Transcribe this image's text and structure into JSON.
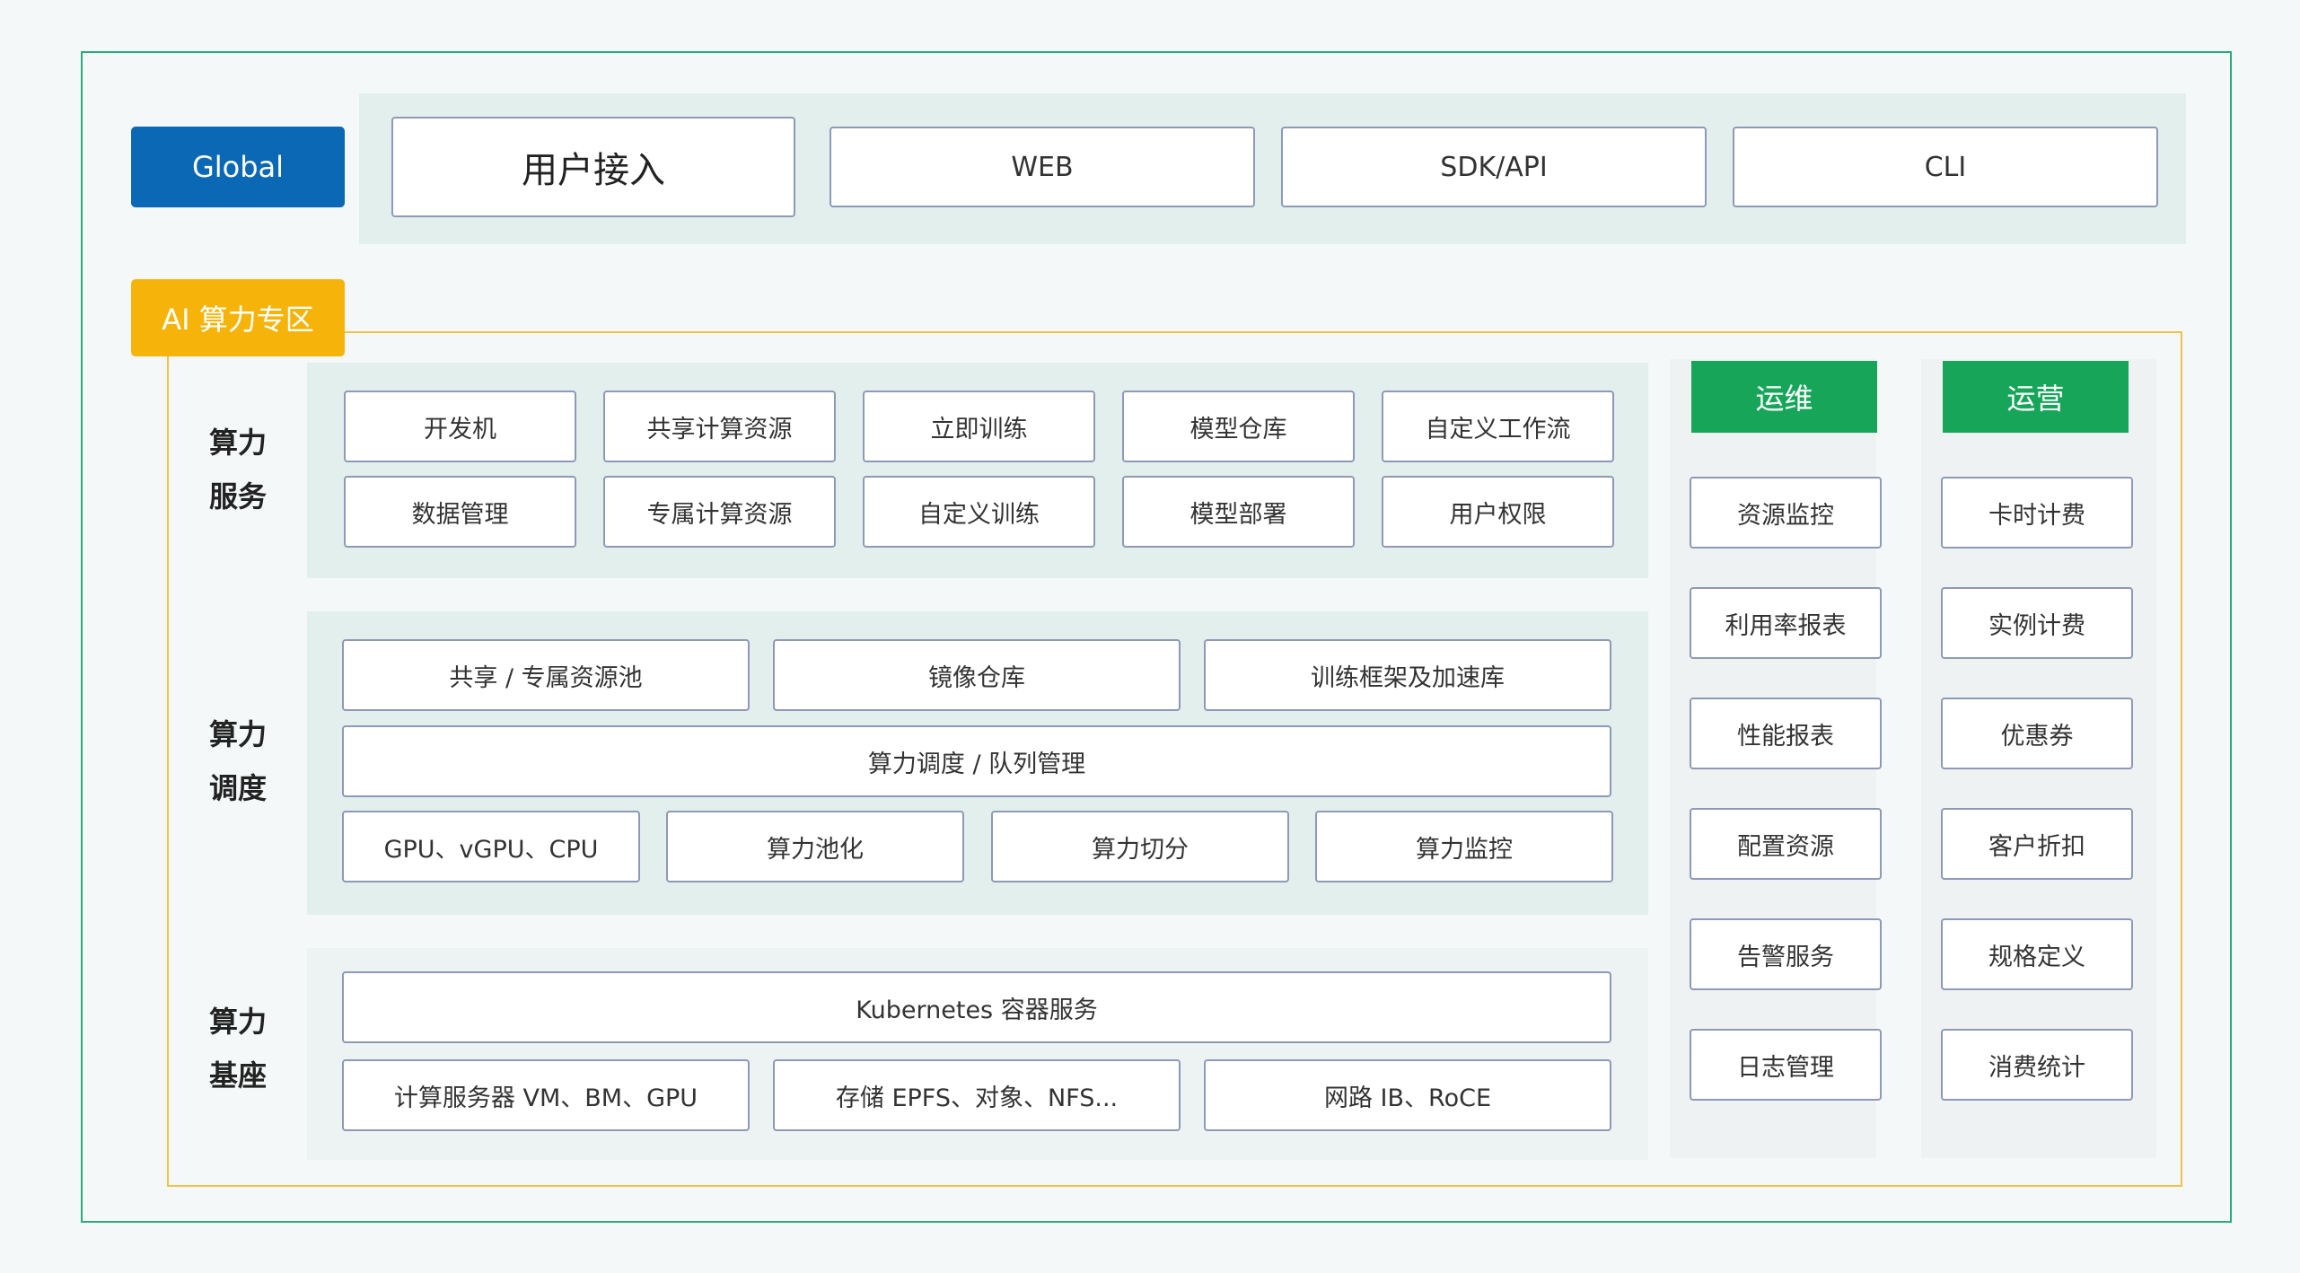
{
  "global": {
    "tag": "Global",
    "user_access": "用户接入",
    "channels": [
      "WEB",
      "SDK/API",
      "CLI"
    ]
  },
  "ai_zone": {
    "tag": "AI 算力专区",
    "service": {
      "label_line1": "算力",
      "label_line2": "服务",
      "row1": [
        "开发机",
        "共享计算资源",
        "立即训练",
        "模型仓库",
        "自定义工作流"
      ],
      "row2": [
        "数据管理",
        "专属计算资源",
        "自定义训练",
        "模型部署",
        "用户权限"
      ]
    },
    "scheduling": {
      "label_line1": "算力",
      "label_line2": "调度",
      "row1": [
        "共享 / 专属资源池",
        "镜像仓库",
        "训练框架及加速库"
      ],
      "row2": "算力调度 / 队列管理",
      "row3": [
        "GPU、vGPU、CPU",
        "算力池化",
        "算力切分",
        "算力监控"
      ]
    },
    "base": {
      "label_line1": "算力",
      "label_line2": "基座",
      "row1": "Kubernetes 容器服务",
      "row2": [
        "计算服务器 VM、BM、GPU",
        "存储 EPFS、对象、NFS...",
        "网路 IB、RoCE"
      ]
    },
    "ops": {
      "title": "运维",
      "items": [
        "资源监控",
        "利用率报表",
        "性能报表",
        "配置资源",
        "告警服务",
        "日志管理"
      ]
    },
    "operation": {
      "title": "运营",
      "items": [
        "卡时计费",
        "实例计费",
        "优惠券",
        "客户折扣",
        "规格定义",
        "消费统计"
      ]
    }
  },
  "colors": {
    "green_frame": "#2bab7a",
    "yellow_frame": "#f0c24a",
    "global_blue": "#0b68b5",
    "ai_yellow": "#f6b40a",
    "ops_green": "#17a659",
    "box_border": "#8e99b8"
  }
}
